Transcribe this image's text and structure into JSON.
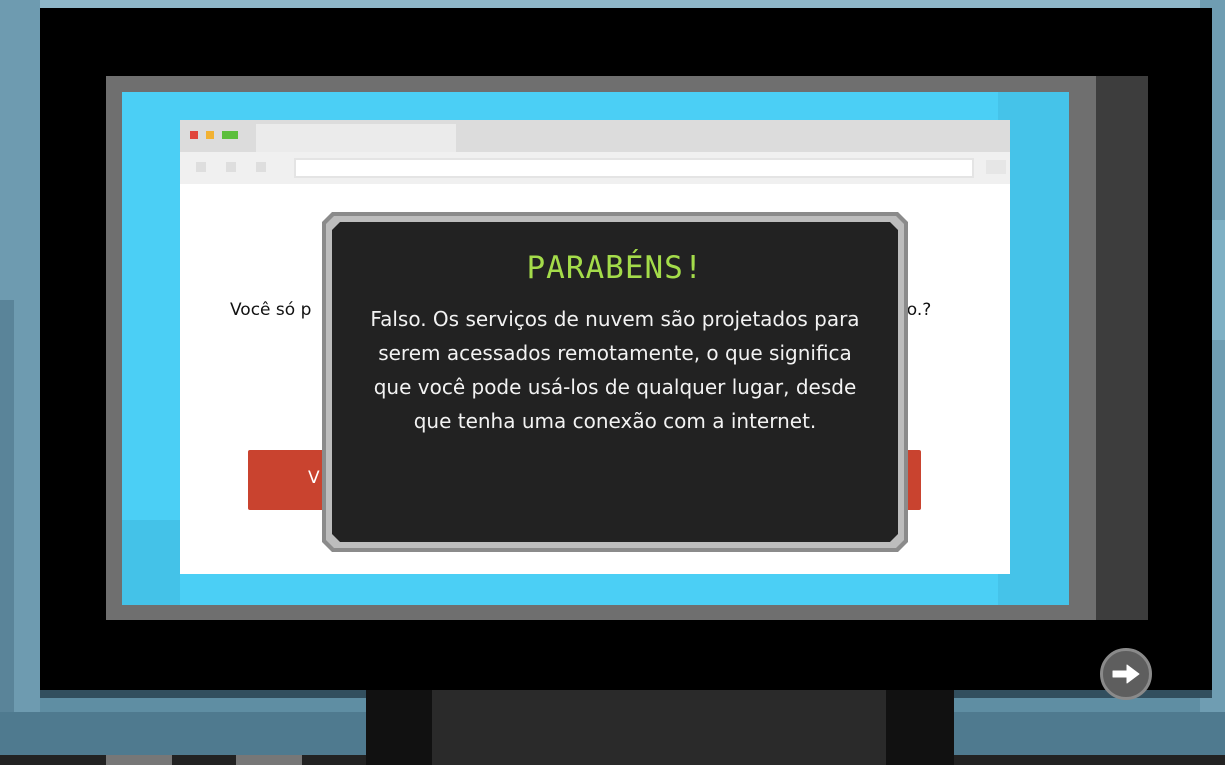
{
  "dialog": {
    "title": "PARABÉNS!",
    "message": "Falso. Os serviços de nuvem são projetados para serem acessados remotamente, o que significa que você pode usá-los de qualquer lugar, desde que tenha uma conexão com a internet."
  },
  "quiz": {
    "question_left_fragment": "Você só p",
    "question_right_fragment": "rio.?",
    "answer_left_fragment": "V"
  },
  "colors": {
    "title": "#a4dc4a",
    "answer_button": "#c9432f",
    "screen": "#4bcff5",
    "dialog_background": "#222222"
  },
  "icons": {
    "next": "arrow-right-icon"
  }
}
